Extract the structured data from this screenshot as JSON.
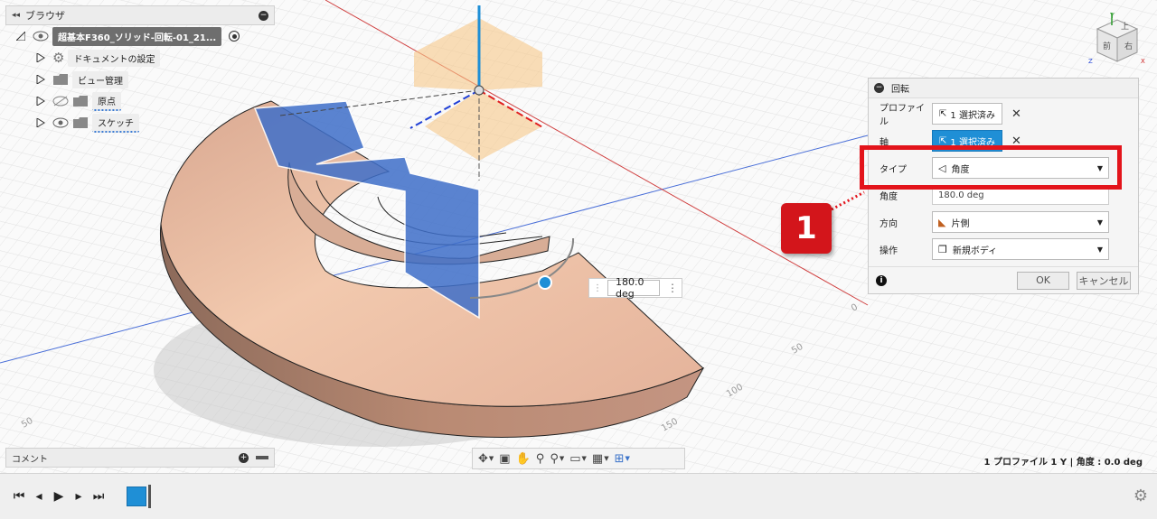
{
  "browser": {
    "title": "ブラウザ",
    "root_label": "超基本F360_ソリッド-回転-01_21...",
    "items": [
      {
        "label": "ドキュメントの設定"
      },
      {
        "label": "ビュー管理"
      },
      {
        "label": "原点"
      },
      {
        "label": "スケッチ"
      }
    ]
  },
  "comment": {
    "title": "コメント"
  },
  "dialog": {
    "title": "回転",
    "profile_label": "プロファイル",
    "profile_value": "1 選択済み",
    "axis_label": "軸",
    "axis_value": "1 選択済み",
    "type_label": "タイプ",
    "type_value": "角度",
    "angle_label": "角度",
    "angle_value": "180.0 deg",
    "direction_label": "方向",
    "direction_value": "片側",
    "operation_label": "操作",
    "operation_value": "新規ボディ",
    "ok_label": "OK",
    "cancel_label": "キャンセル"
  },
  "callout": {
    "number": "1"
  },
  "angle_input": {
    "value": "180.0 deg"
  },
  "status": {
    "text": "1 プロファイル 1 Y | 角度 : 0.0 deg"
  },
  "viewcube": {
    "top": "上",
    "front": "前",
    "right": "右",
    "x": "X",
    "y": "Y",
    "z": "Z"
  },
  "grid_labels": [
    "0",
    "50",
    "100",
    "150",
    "50"
  ],
  "colors": {
    "accent": "#1f8fd6",
    "highlight": "#e3141b",
    "solid": "#e8b89c",
    "profile": "#3f6fc9"
  },
  "icons": {
    "eye": "eye-icon",
    "gear": "gear-icon",
    "folder": "folder-icon",
    "cursor": "cursor-icon",
    "close": "close-icon",
    "info": "info-icon"
  }
}
